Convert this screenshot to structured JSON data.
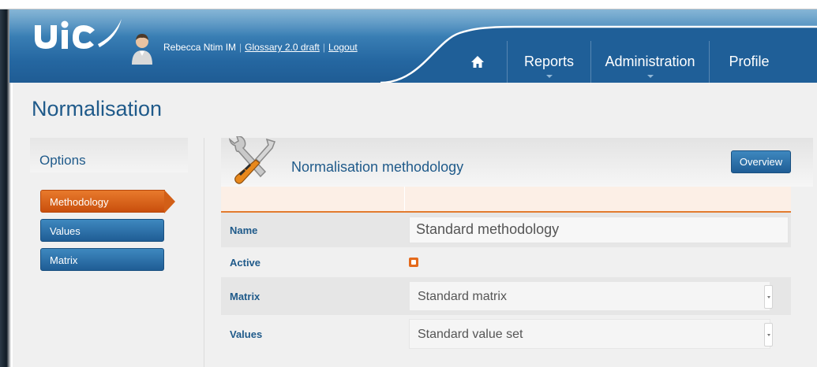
{
  "header": {
    "user_name": "Rebecca Ntim IM",
    "glossary_link": "Glossary 2.0 draft",
    "logout_link": "Logout",
    "nav": {
      "home_icon": "home-icon",
      "reports": "Reports",
      "administration": "Administration",
      "profile": "Profile"
    }
  },
  "page": {
    "title": "Normalisation"
  },
  "sidebar": {
    "title": "Options",
    "items": [
      {
        "label": "Methodology",
        "active": true
      },
      {
        "label": "Values",
        "active": false
      },
      {
        "label": "Matrix",
        "active": false
      }
    ]
  },
  "main": {
    "title": "Normalisation methodology",
    "overview_button": "Overview",
    "form": {
      "name_label": "Name",
      "name_value": "Standard methodology",
      "active_label": "Active",
      "active_checked": true,
      "matrix_label": "Matrix",
      "matrix_value": "Standard matrix",
      "values_label": "Values",
      "values_value": "Standard value set"
    }
  },
  "colors": {
    "header_blue": "#2567a1",
    "title_blue": "#1f5a8a",
    "accent_orange": "#e27b2e"
  }
}
